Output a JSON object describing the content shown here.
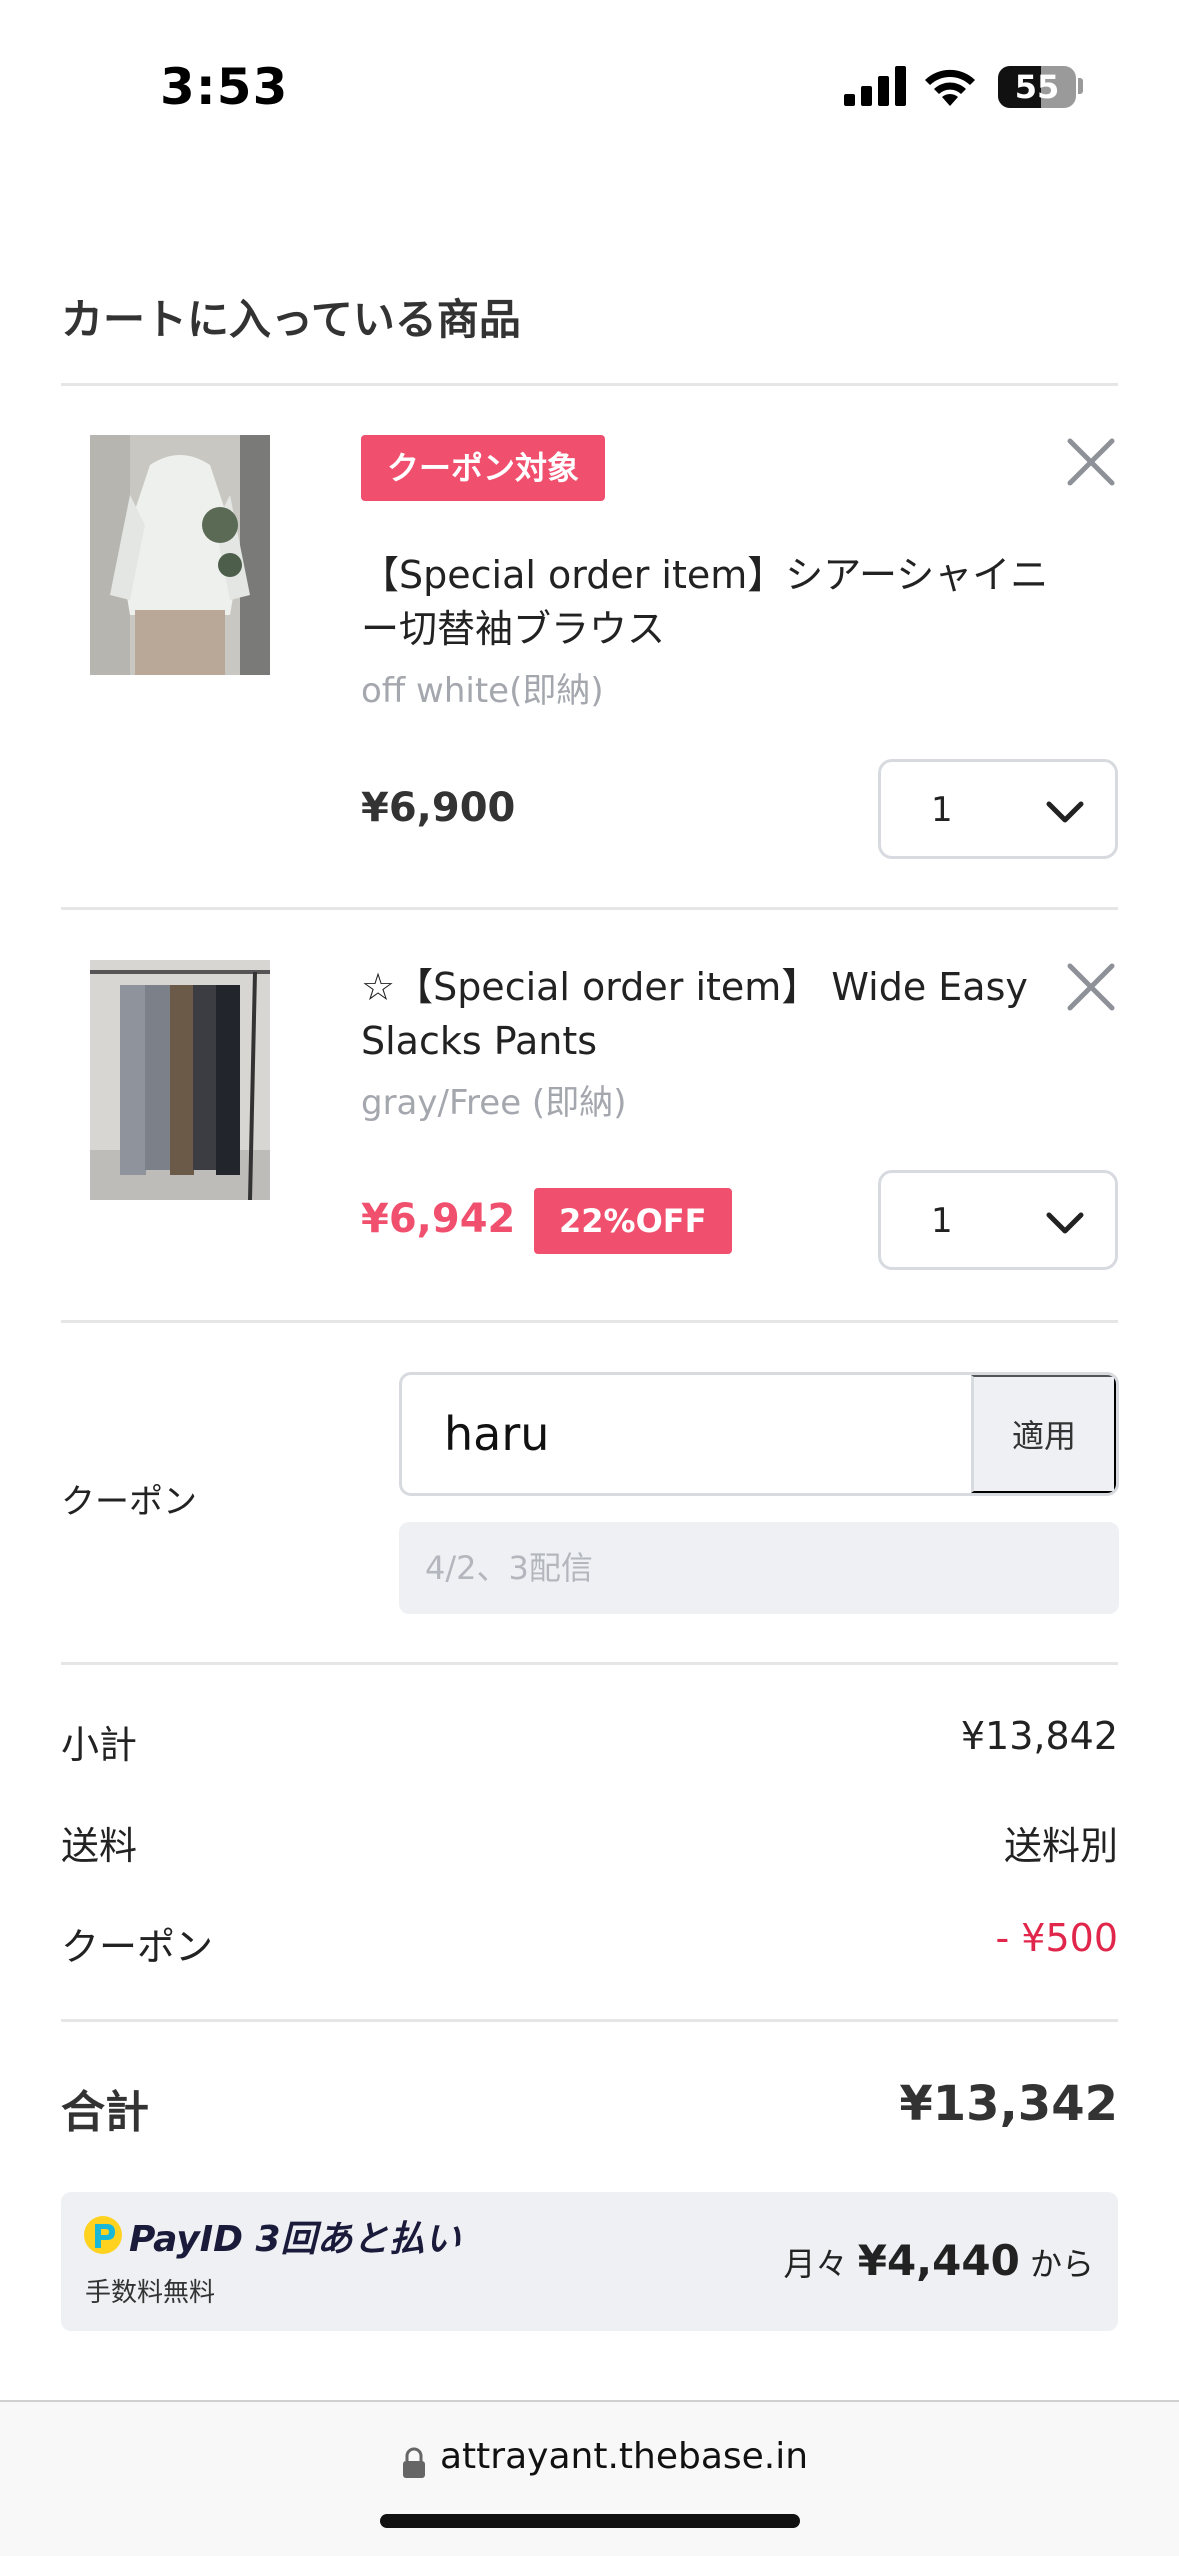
{
  "status_bar": {
    "time": "3:53",
    "battery": "55",
    "battery_level": 0.55
  },
  "page": {
    "title": "カートに入っている商品"
  },
  "cart": {
    "items": [
      {
        "tag": "クーポン対象",
        "name": "【Special order item】シアーシャイニー切替袖ブラウス",
        "variant": "off white(即納)",
        "price": "¥6,900",
        "quantity": "1",
        "icons": {
          "remove": "close-icon",
          "quantity": "chevron-down-icon"
        }
      },
      {
        "name": "☆【Special order item】 Wide Easy Slacks Pants",
        "variant": "gray/Free (即納)",
        "price": "¥6,942",
        "discount_badge": "22%OFF",
        "quantity": "1",
        "icons": {
          "remove": "close-icon",
          "quantity": "chevron-down-icon"
        }
      }
    ]
  },
  "coupon": {
    "label": "クーポン",
    "value": "haru",
    "apply_label": "適用",
    "note": "4/2、3配信"
  },
  "summary": {
    "subtotal_label": "小計",
    "subtotal_value": "¥13,842",
    "shipping_label": "送料",
    "shipping_value": "送料別",
    "coupon_label": "クーポン",
    "coupon_value": "- ¥500",
    "total_label": "合計",
    "total_value": "¥13,342"
  },
  "payid": {
    "title": "PayID 3回あと払い",
    "subtitle": "手数料無料",
    "prefix": "月々",
    "amount": "¥4,440",
    "suffix": "から"
  },
  "browser": {
    "url": "attrayant.thebase.in"
  },
  "colors": {
    "accent": "#f0506e",
    "discount_red": "#e0264a",
    "muted_text": "#a4a7ad",
    "panel_bg": "#eef0f4"
  }
}
